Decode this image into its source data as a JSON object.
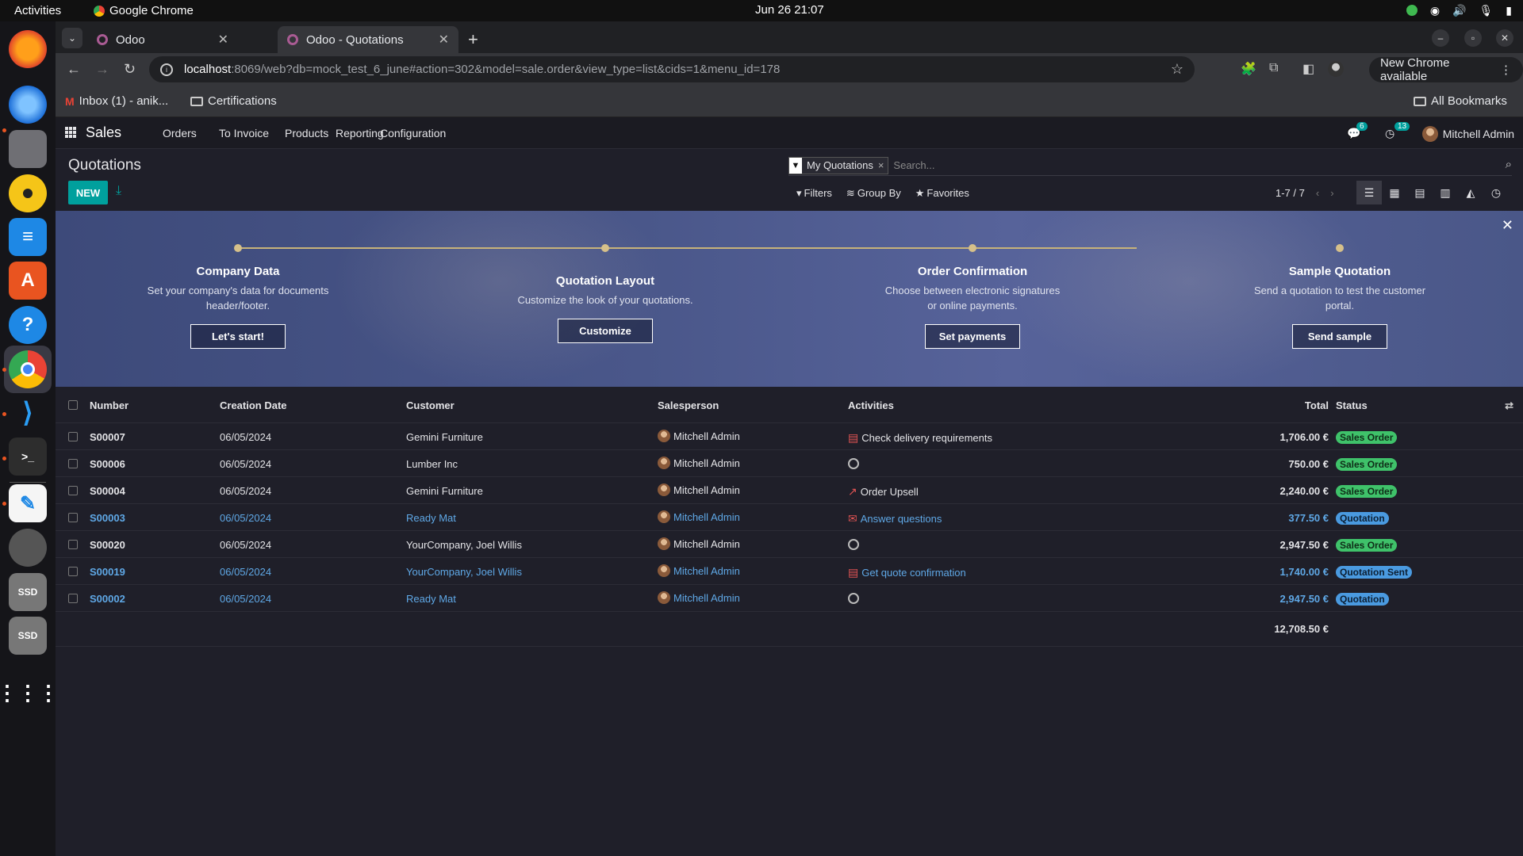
{
  "system": {
    "activities": "Activities",
    "app_name": "Google Chrome",
    "clock": "Jun 26  21:07"
  },
  "chrome": {
    "tabs": [
      {
        "title": "Odoo"
      },
      {
        "title": "Odoo - Quotations"
      }
    ],
    "url_host": "localhost",
    "url_path": ":8069/web?db=mock_test_6_june#action=302&model=sale.order&view_type=list&cids=1&menu_id=178",
    "new_chrome": "New Chrome available",
    "bookmarks": [
      {
        "label": "Inbox (1) - anik..."
      },
      {
        "label": "Certifications"
      }
    ],
    "all_bookmarks": "All Bookmarks"
  },
  "odoo": {
    "app": "Sales",
    "menu": [
      "Orders",
      "To Invoice",
      "Products",
      "Reporting",
      "Configuration"
    ],
    "messages_count": "6",
    "activities_count": "13",
    "user": "Mitchell Admin",
    "page_title": "Quotations",
    "new_label": "NEW",
    "facet": "My Quotations",
    "search_placeholder": "Search...",
    "filters": "Filters",
    "group_by": "Group By",
    "favorites": "Favorites",
    "pager": "1-7 / 7"
  },
  "banner": {
    "steps": [
      {
        "title": "Company Data",
        "desc": "Set your company's data for documents header/footer.",
        "button": "Let's start!"
      },
      {
        "title": "Quotation Layout",
        "desc": "Customize the look of your quotations.",
        "button": "Customize"
      },
      {
        "title": "Order Confirmation",
        "desc": "Choose between electronic signatures or online payments.",
        "button": "Set payments"
      },
      {
        "title": "Sample Quotation",
        "desc": "Send a quotation to test the customer portal.",
        "button": "Send sample"
      }
    ]
  },
  "table": {
    "columns": {
      "number": "Number",
      "date": "Creation Date",
      "customer": "Customer",
      "salesperson": "Salesperson",
      "activities": "Activities",
      "total": "Total",
      "status": "Status"
    },
    "rows": [
      {
        "number": "S00007",
        "date": "06/05/2024",
        "customer": "Gemini Furniture",
        "salesperson": "Mitchell Admin",
        "activity": "Check delivery requirements",
        "total": "1,706.00 €",
        "status": "Sales Order"
      },
      {
        "number": "S00006",
        "date": "06/05/2024",
        "customer": "Lumber Inc",
        "salesperson": "Mitchell Admin",
        "activity": "",
        "total": "750.00 €",
        "status": "Sales Order"
      },
      {
        "number": "S00004",
        "date": "06/05/2024",
        "customer": "Gemini Furniture",
        "salesperson": "Mitchell Admin",
        "activity": "Order Upsell",
        "total": "2,240.00 €",
        "status": "Sales Order"
      },
      {
        "number": "S00003",
        "date": "06/05/2024",
        "customer": "Ready Mat",
        "salesperson": "Mitchell Admin",
        "activity": "Answer questions",
        "total": "377.50 €",
        "status": "Quotation"
      },
      {
        "number": "S00020",
        "date": "06/05/2024",
        "customer": "YourCompany, Joel Willis",
        "salesperson": "Mitchell Admin",
        "activity": "",
        "total": "2,947.50 €",
        "status": "Sales Order"
      },
      {
        "number": "S00019",
        "date": "06/05/2024",
        "customer": "YourCompany, Joel Willis",
        "salesperson": "Mitchell Admin",
        "activity": "Get quote confirmation",
        "total": "1,740.00 €",
        "status": "Quotation Sent"
      },
      {
        "number": "S00002",
        "date": "06/05/2024",
        "customer": "Ready Mat",
        "salesperson": "Mitchell Admin",
        "activity": "",
        "total": "2,947.50 €",
        "status": "Quotation"
      }
    ],
    "grand_total": "12,708.50 €"
  },
  "colors": {
    "accent": "#00a09d",
    "link": "#5fa8e6",
    "status_order": "#3fc26a",
    "status_quote": "#4a9ae0"
  }
}
